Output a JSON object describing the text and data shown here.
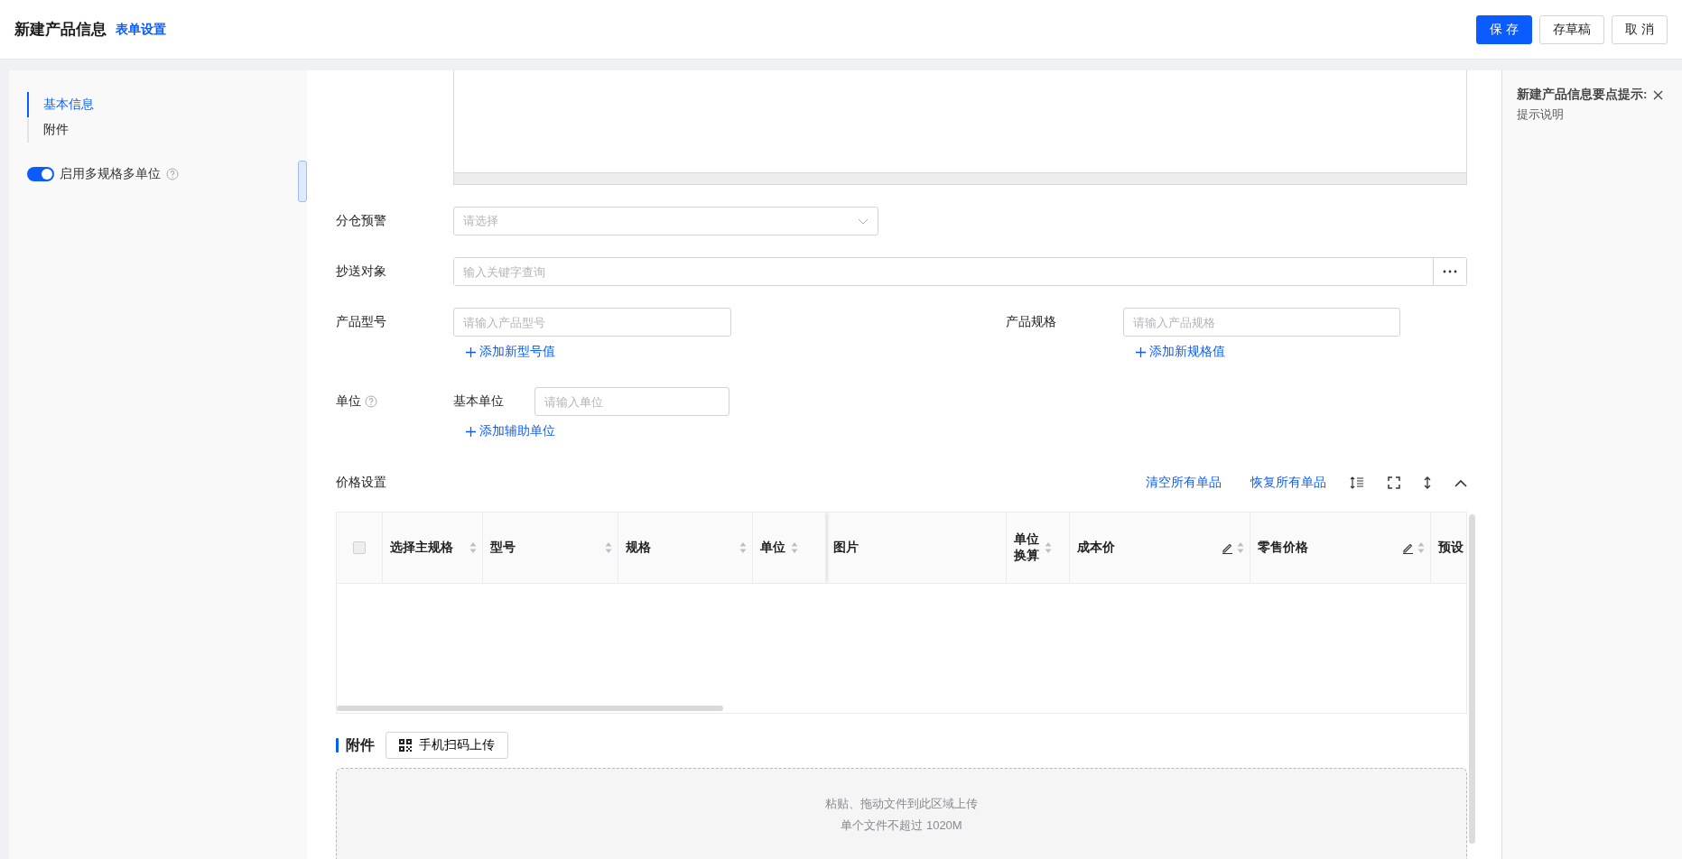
{
  "header": {
    "title": "新建产品信息",
    "settings_link": "表单设置",
    "buttons": [
      {
        "label": "保 存",
        "kind": "primary"
      },
      {
        "label": "存草稿",
        "kind": "default"
      },
      {
        "label": "取 消",
        "kind": "default"
      }
    ]
  },
  "nav": {
    "items": [
      {
        "label": "基本信息",
        "selected": true
      },
      {
        "label": "附件",
        "selected": false
      }
    ],
    "toggle": {
      "label": "启用多规格多单位",
      "on": true
    }
  },
  "form": {
    "warehouse_alert": {
      "label": "分仓预警",
      "placeholder": "请选择"
    },
    "cc": {
      "label": "抄送对象",
      "placeholder": "输入关键字查询"
    },
    "model": {
      "label": "产品型号",
      "placeholder": "请输入产品型号",
      "add": "添加新型号值"
    },
    "spec": {
      "label": "产品规格",
      "placeholder": "请输入产品规格",
      "add": "添加新规格值"
    },
    "unit": {
      "label": "单位",
      "base_label": "基本单位",
      "placeholder": "请输入单位",
      "add": "添加辅助单位"
    }
  },
  "price": {
    "title": "价格设置",
    "actions": [
      "清空所有单品",
      "恢复所有单品"
    ],
    "select_all": {
      "checked": false
    },
    "columns": [
      {
        "label": "选择主规格",
        "sortable": true,
        "editable": false
      },
      {
        "label": "型号",
        "sortable": true,
        "editable": false
      },
      {
        "label": "规格",
        "sortable": true,
        "editable": false
      },
      {
        "label": "单位",
        "sortable": true,
        "editable": false
      },
      {
        "label": "图片",
        "sortable": false,
        "editable": false
      },
      {
        "label": "单位换算",
        "sortable": true,
        "editable": false
      },
      {
        "label": "成本价",
        "sortable": true,
        "editable": true
      },
      {
        "label": "零售价格",
        "sortable": true,
        "editable": true
      },
      {
        "label": "预设"
      }
    ]
  },
  "attachments": {
    "title": "附件",
    "scan_button": "手机扫码上传",
    "drop_text": "粘贴、拖动文件到此区域上传",
    "limit_text": "单个文件不超过 1020M"
  },
  "tips": {
    "title": "新建产品信息要点提示:",
    "body": "提示说明"
  }
}
